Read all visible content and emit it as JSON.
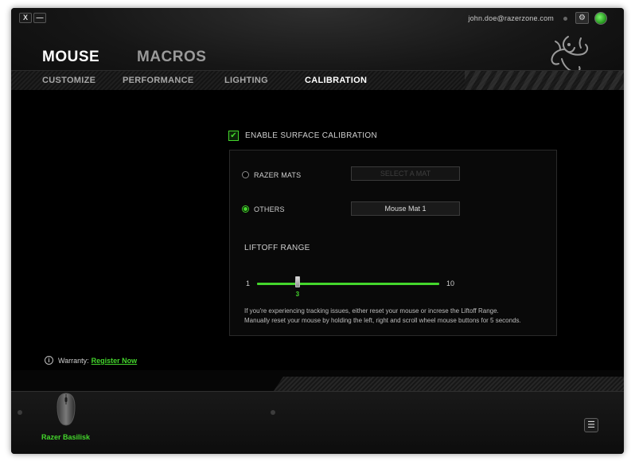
{
  "window": {
    "close_label": "X",
    "minimize_label": "—",
    "account_email": "john.doe@razerzone.com",
    "settings_glyph": "⚙",
    "icons": [
      "close-icon",
      "minimize-icon",
      "gear-icon",
      "sync-icon",
      "razer-logo-icon"
    ]
  },
  "main_tabs": [
    {
      "label": "MOUSE",
      "active": true
    },
    {
      "label": "MACROS",
      "active": false
    }
  ],
  "sub_tabs": [
    {
      "label": "CUSTOMIZE",
      "active": false
    },
    {
      "label": "PERFORMANCE",
      "active": false
    },
    {
      "label": "LIGHTING",
      "active": false
    },
    {
      "label": "CALIBRATION",
      "active": true
    }
  ],
  "calibration": {
    "enable_label": "ENABLE SURFACE CALIBRATION",
    "enabled": true,
    "check_glyph": "✔",
    "options": [
      {
        "label": "RAZER MATS",
        "selected": false,
        "select_value": "SELECT A MAT",
        "select_enabled": false
      },
      {
        "label": "OTHERS",
        "selected": true,
        "select_value": "Mouse Mat 1",
        "select_enabled": true
      }
    ],
    "liftoff": {
      "title": "LIFTOFF RANGE",
      "min_label": "1",
      "max_label": "10",
      "min": 1,
      "max": 10,
      "value": 3,
      "value_label": "3"
    },
    "help_text_line1": "If you're experiencing tracking issues, either reset your mouse or increse the Liftoff Range.",
    "help_text_line2": "Manually reset your mouse by holding the left, right and scroll wheel mouse buttons for 5 seconds."
  },
  "warranty": {
    "info_glyph": "i",
    "label": "Warranty:",
    "link_text": "Register Now"
  },
  "footer": {
    "device_name": "Razer Basilisk",
    "menu_glyph": "☰"
  },
  "colors": {
    "accent": "#44d62c",
    "background": "#000000",
    "text": "#cfcfcf"
  }
}
